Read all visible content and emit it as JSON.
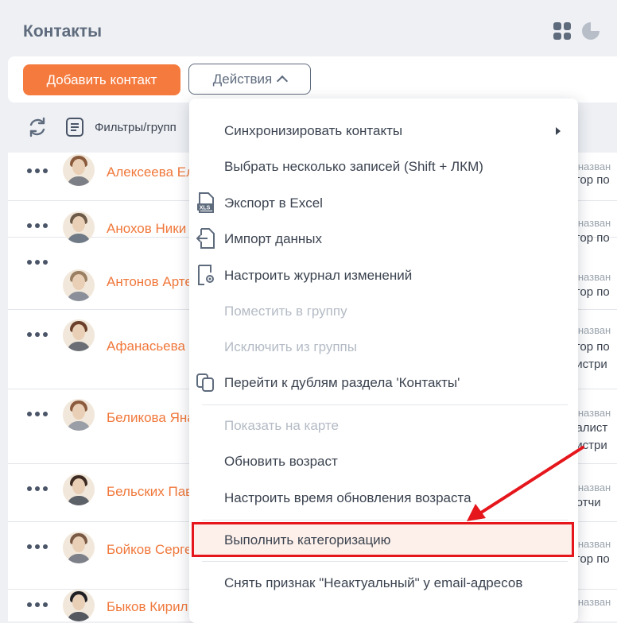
{
  "header": {
    "title": "Контакты"
  },
  "toolbar": {
    "add_label": "Добавить контакт",
    "actions_label": "Действия"
  },
  "filters": {
    "label": "Фильтры/групп"
  },
  "menu": {
    "items": [
      {
        "label": "Синхронизировать контакты",
        "disabled": false,
        "submenu": true
      },
      {
        "label": "Выбрать несколько записей (Shift + ЛКМ)",
        "disabled": false
      },
      {
        "label": "Экспорт в Excel",
        "disabled": false,
        "icon": "excel-export-icon"
      },
      {
        "label": "Импорт данных",
        "disabled": false,
        "icon": "import-icon"
      },
      {
        "label": "Настроить журнал изменений",
        "disabled": false,
        "icon": "change-log-settings-icon"
      },
      {
        "label": "Поместить в группу",
        "disabled": true
      },
      {
        "label": "Исключить из группы",
        "disabled": true
      },
      {
        "label": "Перейти к дублям раздела 'Контакты'",
        "disabled": false,
        "icon": "duplicates-icon"
      },
      {
        "label": "Показать на карте",
        "disabled": true
      },
      {
        "label": "Обновить возраст",
        "disabled": false
      },
      {
        "label": "Настроить время обновления возраста",
        "disabled": false
      },
      {
        "label": "Выполнить категоризацию",
        "disabled": false,
        "highlighted": true
      },
      {
        "label": "Снять признак \"Неактуальный\" у email-адресов",
        "disabled": false
      }
    ],
    "excel_icon_text": "XLS"
  },
  "contacts": [
    {
      "name": "Алексеева Ел",
      "r1": "е назван",
      "r2": "ктор по",
      "r3": ""
    },
    {
      "name": "Анохов Ники",
      "r1": "е назван",
      "r2": "ктор по",
      "r3": ""
    },
    {
      "name": "Антонов Арте",
      "r1": "е назван",
      "r2": "ктор по",
      "r3": ""
    },
    {
      "name": "Афанасьева Е",
      "r1": "е назван",
      "r2": "ктор по",
      "r3": "нистри"
    },
    {
      "name": "Беликова Яна",
      "r1": "е назван",
      "r2": "иалист",
      "r3": "нистри"
    },
    {
      "name": "Бельских Пав",
      "r1": "е назван",
      "r2": "ботчи",
      "r3": ""
    },
    {
      "name": "Бойков Серге",
      "r1": "е назван",
      "r2": "ктор по",
      "r3": ""
    },
    {
      "name": "Быков Кирил",
      "r1": "е назван",
      "r2": "",
      "r3": ""
    }
  ],
  "colors": {
    "accent": "#f57a3d",
    "highlight_border": "#e5161c",
    "link": "#f0783b"
  }
}
